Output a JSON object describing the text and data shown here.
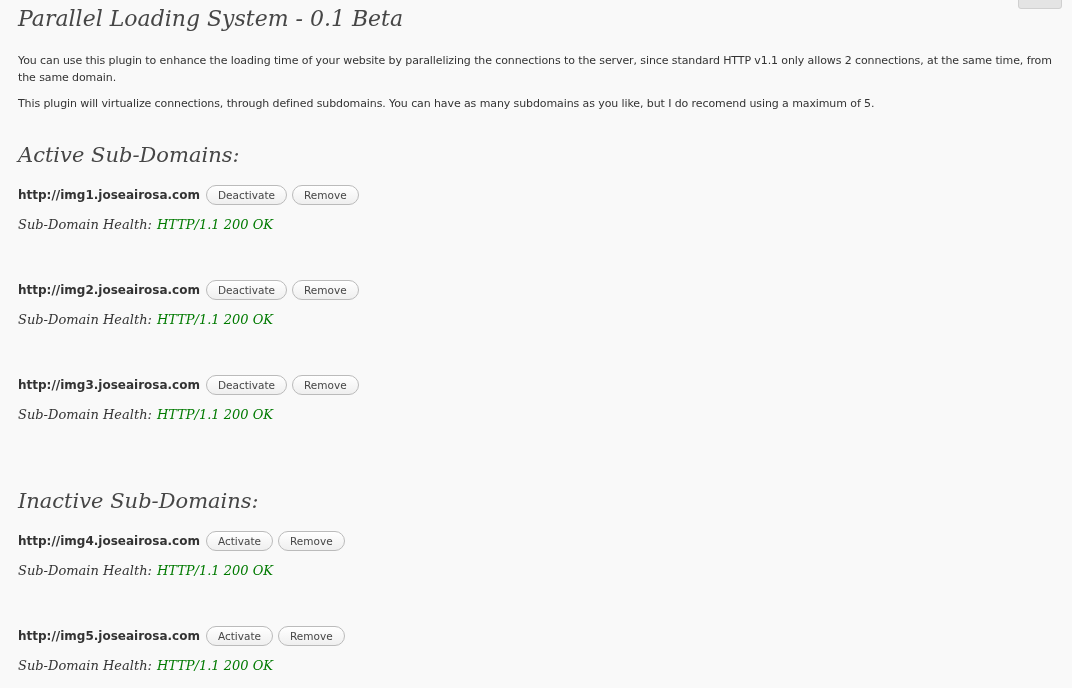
{
  "title": "Parallel Loading System - 0.1 Beta",
  "paragraphs": [
    "You can use this plugin to enhance the loading time of your website by parallelizing the connections to the server, since standard HTTP v1.1 only allows 2 connections, at the same time, from the same domain.",
    "This plugin will virtualize connections, through defined subdomains. You can have as many subdomains as you like, but I do recomend using a maximum of 5."
  ],
  "sections": [
    {
      "heading": "Active Sub-Domains:",
      "domains": [
        {
          "url": "http://img1.joseairosa.com",
          "buttons": [
            "Deactivate",
            "Remove"
          ],
          "health_label": "Sub-Domain Health:",
          "health_status": "HTTP/1.1 200 OK"
        },
        {
          "url": "http://img2.joseairosa.com",
          "buttons": [
            "Deactivate",
            "Remove"
          ],
          "health_label": "Sub-Domain Health:",
          "health_status": "HTTP/1.1 200 OK"
        },
        {
          "url": "http://img3.joseairosa.com",
          "buttons": [
            "Deactivate",
            "Remove"
          ],
          "health_label": "Sub-Domain Health:",
          "health_status": "HTTP/1.1 200 OK"
        }
      ]
    },
    {
      "heading": "Inactive Sub-Domains:",
      "domains": [
        {
          "url": "http://img4.joseairosa.com",
          "buttons": [
            "Activate",
            "Remove"
          ],
          "health_label": "Sub-Domain Health:",
          "health_status": "HTTP/1.1 200 OK"
        },
        {
          "url": "http://img5.joseairosa.com",
          "buttons": [
            "Activate",
            "Remove"
          ],
          "health_label": "Sub-Domain Health:",
          "health_status": "HTTP/1.1 200 OK"
        }
      ]
    }
  ]
}
